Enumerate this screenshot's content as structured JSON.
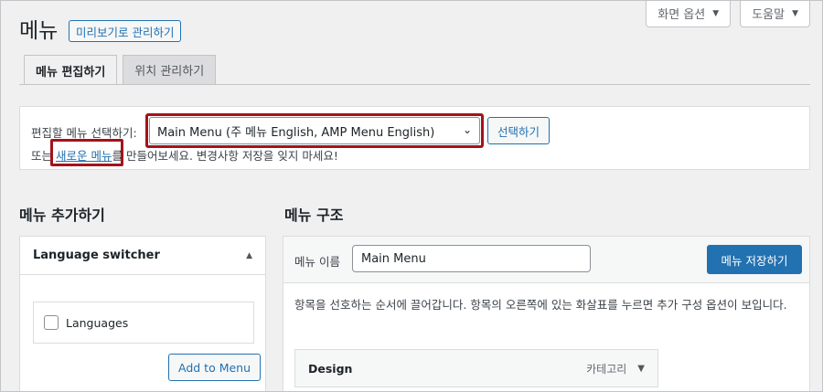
{
  "screen_meta": {
    "screen_options_label": "화면 옵션",
    "help_label": "도움말"
  },
  "page": {
    "title": "메뉴",
    "preview_button": "미리보기로 관리하기"
  },
  "tabs": [
    {
      "label": "메뉴 편집하기",
      "active": true
    },
    {
      "label": "위치 관리하기",
      "active": false
    }
  ],
  "select_panel": {
    "label": "편집할 메뉴 선택하기:",
    "selected_menu": "Main Menu (주 메뉴 English, AMP Menu English)",
    "choose_button": "선택하기",
    "or_prefix": "또는",
    "new_menu_link": "새로운 메뉴",
    "or_suffix": "를 만들어보세요. 변경사항 저장을 잊지 마세요!"
  },
  "add_items": {
    "heading": "메뉴 추가하기",
    "accordion_title": "Language switcher",
    "checkbox_label": "Languages",
    "add_button": "Add to Menu"
  },
  "structure": {
    "heading": "메뉴 구조",
    "name_label": "메뉴 이름",
    "name_value": "Main Menu",
    "save_button": "메뉴 저장하기",
    "instructions": "항목을 선호하는 순서에 끌어갑니다. 항목의 오른쪽에 있는 화살표를 누르면 추가 구성 옵션이 보입니다.",
    "items": [
      {
        "title": "Design",
        "type": "카테고리"
      }
    ]
  },
  "colors": {
    "accent": "#2271b1",
    "highlight": "#a3131a",
    "background": "#f0f0f1"
  }
}
